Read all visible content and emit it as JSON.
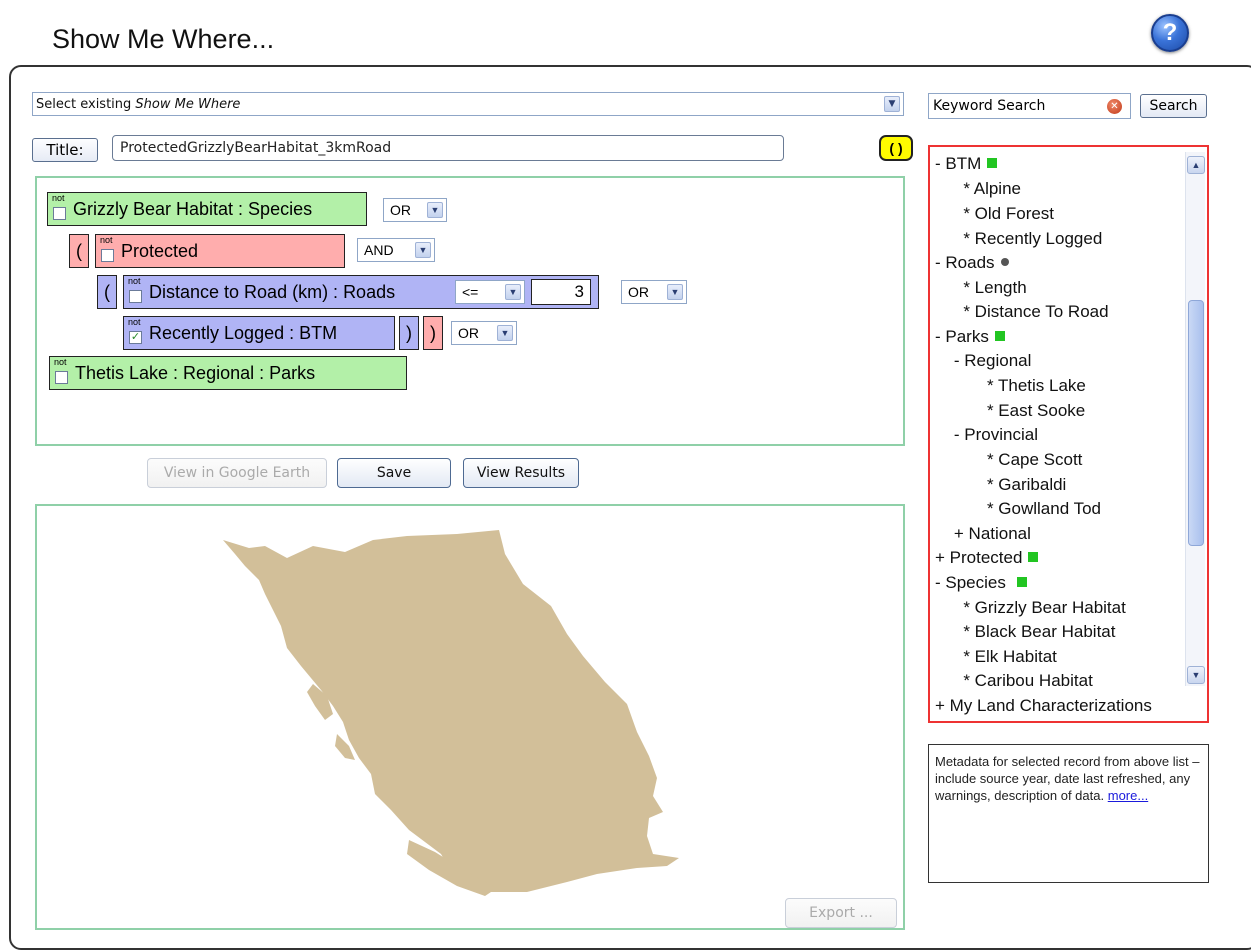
{
  "header": {
    "title": "Show Me Where...",
    "help_label": "?"
  },
  "existing_select": {
    "prefix": "Select existing ",
    "value_italic": "Show Me Where"
  },
  "title_row": {
    "label": "Title:",
    "value": "ProtectedGrizzlyBearHabitat_3kmRoad",
    "paren_button": "( )"
  },
  "query": {
    "not_label": "not",
    "rows": [
      {
        "text": "Grizzly Bear Habitat : Species",
        "checked": false,
        "operator": "OR"
      },
      {
        "open_paren": "(",
        "text": "Protected",
        "checked": false,
        "operator": "AND"
      },
      {
        "open_paren": "(",
        "text": "Distance to Road (km) : Roads",
        "checked": false,
        "comparator": "<=",
        "value": "3",
        "operator": "OR"
      },
      {
        "text": "Recently Logged : BTM",
        "checked": true,
        "close_parens": [
          ")",
          ")"
        ],
        "operator": "OR"
      },
      {
        "text": "Thetis Lake : Regional : Parks",
        "checked": false
      }
    ]
  },
  "actions": {
    "google_earth": "View in Google Earth",
    "save": "Save",
    "view_results": "View Results"
  },
  "map": {
    "export": "Export ...",
    "land_color": "#d2bf99"
  },
  "search": {
    "placeholder": "Keyword Search",
    "button": "Search"
  },
  "tree": {
    "lines": [
      {
        "text": "- BTM",
        "marker": "square"
      },
      {
        "text": "      * Alpine"
      },
      {
        "text": "      * Old Forest"
      },
      {
        "text": "      * Recently Logged"
      },
      {
        "text": "- Roads",
        "marker": "dot"
      },
      {
        "text": "      * Length"
      },
      {
        "text": "      * Distance To Road"
      },
      {
        "text": "- Parks",
        "marker": "square"
      },
      {
        "text": "    - Regional"
      },
      {
        "text": "           * Thetis Lake"
      },
      {
        "text": "           * East Sooke"
      },
      {
        "text": "    - Provincial"
      },
      {
        "text": "           * Cape Scott"
      },
      {
        "text": "           * Garibaldi"
      },
      {
        "text": "           * Gowlland Tod"
      },
      {
        "text": "    + National"
      },
      {
        "text": "+ Protected",
        "marker": "square"
      },
      {
        "text": "- Species ",
        "marker": "square"
      },
      {
        "text": "      * Grizzly Bear Habitat"
      },
      {
        "text": "      * Black Bear Habitat"
      },
      {
        "text": "      * Elk Habitat"
      },
      {
        "text": "      * Caribou Habitat"
      },
      {
        "text": "+ My Land Characterizations"
      }
    ],
    "marker_color": "#22c522"
  },
  "metadata": {
    "text": "Metadata for selected record from above list – include source year, date last refreshed, any warnings, description of data.",
    "link": "more..."
  }
}
